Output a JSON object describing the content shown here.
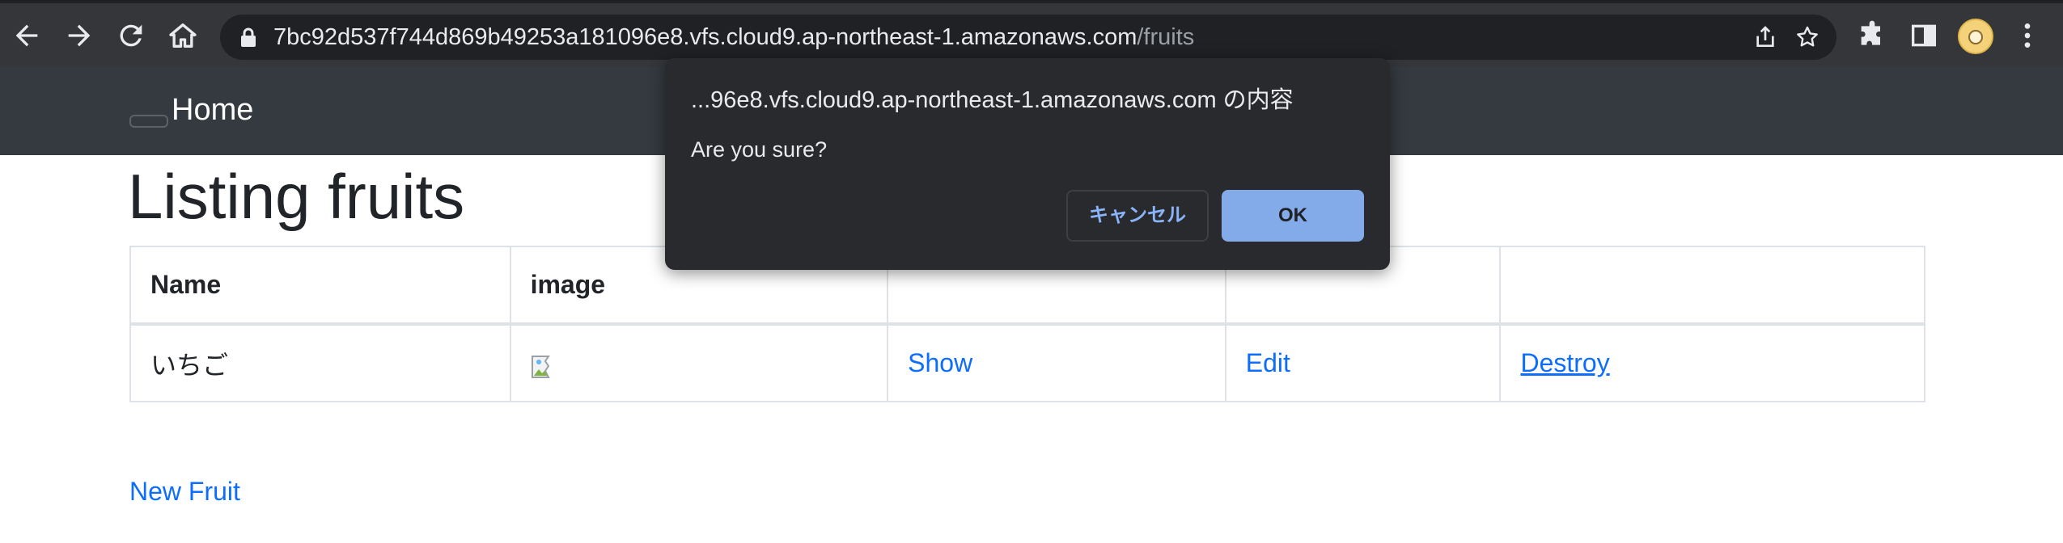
{
  "browser": {
    "url_host": "7bc92d537f744d869b49253a181096e8.vfs.cloud9.ap-northeast-1.amazonaws.com",
    "url_path": "/fruits"
  },
  "navbar": {
    "brand": "Home"
  },
  "main": {
    "title": "Listing fruits",
    "table": {
      "headers": [
        "Name",
        "image",
        "",
        "",
        ""
      ],
      "rows": [
        {
          "name": "いちご",
          "show": "Show",
          "edit": "Edit",
          "destroy": "Destroy"
        }
      ]
    },
    "new_link": "New Fruit"
  },
  "dialog": {
    "title": "...96e8.vfs.cloud9.ap-northeast-1.amazonaws.com の内容",
    "message": "Are you sure?",
    "cancel_label": "キャンセル",
    "ok_label": "OK"
  },
  "colors": {
    "link": "#0d6efd",
    "navbar": "#343a40",
    "dialog_bg": "#292a2d",
    "ok_button": "#8ab4f8"
  }
}
